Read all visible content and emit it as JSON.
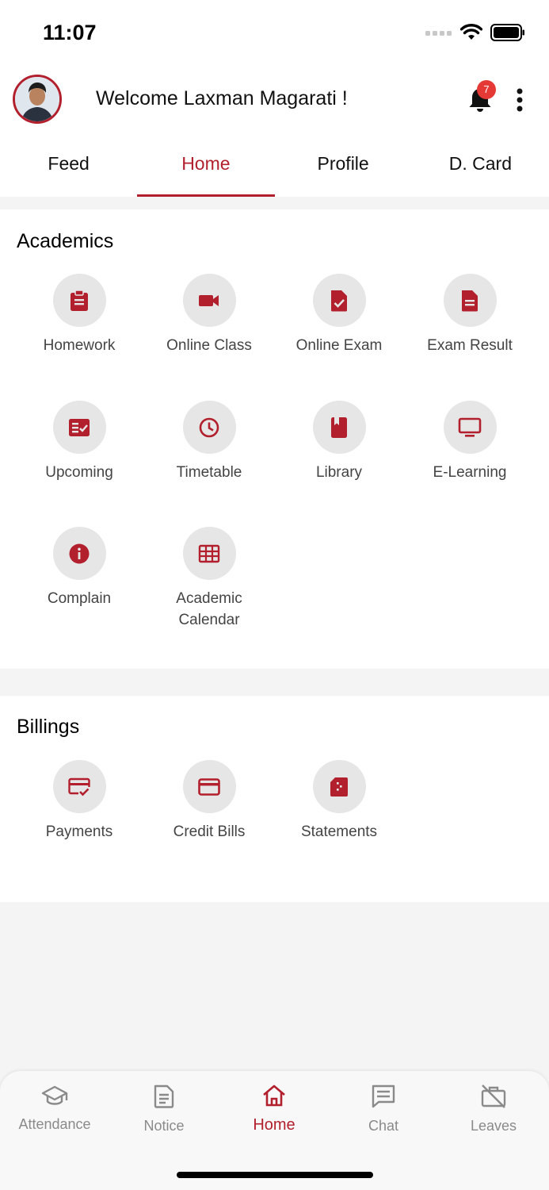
{
  "status_bar": {
    "time": "11:07"
  },
  "header": {
    "welcome": "Welcome Laxman Magarati !",
    "notification_count": "7"
  },
  "tabs": [
    {
      "label": "Feed",
      "active": false
    },
    {
      "label": "Home",
      "active": true
    },
    {
      "label": "Profile",
      "active": false
    },
    {
      "label": "D. Card",
      "active": false
    }
  ],
  "academics": {
    "title": "Academics",
    "items": [
      {
        "label": "Homework",
        "icon": "clipboard-icon"
      },
      {
        "label": "Online Class",
        "icon": "video-camera-icon"
      },
      {
        "label": "Online Exam",
        "icon": "file-check-icon"
      },
      {
        "label": "Exam Result",
        "icon": "document-icon"
      },
      {
        "label": "Upcoming",
        "icon": "list-check-icon"
      },
      {
        "label": "Timetable",
        "icon": "clock-icon"
      },
      {
        "label": "Library",
        "icon": "book-icon"
      },
      {
        "label": "E-Learning",
        "icon": "monitor-icon"
      },
      {
        "label": "Complain",
        "icon": "info-icon"
      },
      {
        "label": "Academic\nCalendar",
        "icon": "grid-calendar-icon"
      }
    ]
  },
  "billings": {
    "title": "Billings",
    "items": [
      {
        "label": "Payments",
        "icon": "payment-check-icon"
      },
      {
        "label": "Credit Bills",
        "icon": "credit-card-icon"
      },
      {
        "label": "Statements",
        "icon": "statement-icon"
      }
    ]
  },
  "bottom_nav": [
    {
      "label": "Attendance",
      "icon": "graduation-cap-icon",
      "active": false
    },
    {
      "label": "Notice",
      "icon": "notice-icon",
      "active": false
    },
    {
      "label": "Home",
      "icon": "home-icon",
      "active": true
    },
    {
      "label": "Chat",
      "icon": "chat-icon",
      "active": false
    },
    {
      "label": "Leaves",
      "icon": "leave-icon",
      "active": false
    }
  ],
  "colors": {
    "accent": "#b21f2d",
    "badge": "#e53935",
    "tile_bg": "#e6e6e6"
  }
}
